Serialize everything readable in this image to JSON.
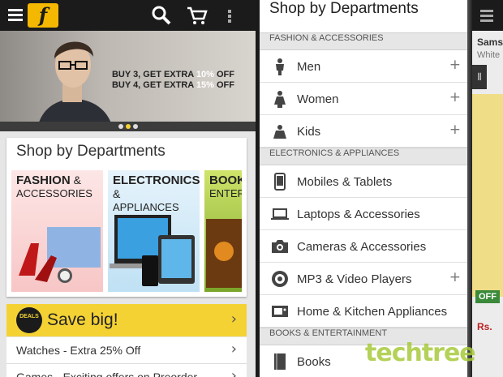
{
  "left": {
    "banner": {
      "line1_prefix": "BUY 3, GET EXTRA ",
      "line1_pct": "10%",
      "line1_suffix": " OFF",
      "line2_prefix": "BUY 4, GET EXTRA ",
      "line2_pct": "15%",
      "line2_suffix": " OFF"
    },
    "card_title": "Shop by Departments",
    "tiles": [
      {
        "line1": "FASHION",
        "amp": " &",
        "line2": "ACCESSORIES"
      },
      {
        "line1": "ELECTRONICS",
        "amp": " &",
        "line2": "APPLIANCES"
      },
      {
        "line1": "BOOKS",
        "amp": "",
        "line2": "ENTER"
      }
    ],
    "save_badge": "DEALS",
    "save_label": "Save big!",
    "rows": [
      "Watches - Extra 25% Off",
      "Games - Exciting offers on Preorder"
    ]
  },
  "drawer": {
    "title": "Shop by Departments",
    "sections": [
      {
        "header": "FASHION & ACCESSORIES",
        "items": [
          {
            "label": "Men",
            "icon": "man-icon",
            "expand": "+"
          },
          {
            "label": "Women",
            "icon": "woman-icon",
            "expand": "+"
          },
          {
            "label": "Kids",
            "icon": "kids-icon",
            "expand": "+"
          }
        ]
      },
      {
        "header": "ELECTRONICS & APPLIANCES",
        "items": [
          {
            "label": "Mobiles & Tablets",
            "icon": "mobile-icon",
            "expand": ""
          },
          {
            "label": "Laptops & Accessories",
            "icon": "laptop-icon",
            "expand": ""
          },
          {
            "label": "Cameras & Accessories",
            "icon": "camera-icon",
            "expand": ""
          },
          {
            "label": "MP3 & Video Players",
            "icon": "music-player-icon",
            "expand": "+"
          },
          {
            "label": "Home & Kitchen Appliances",
            "icon": "home-appliance-icon",
            "expand": ""
          }
        ]
      },
      {
        "header": "BOOKS & ENTERTAINMENT",
        "items": [
          {
            "label": "Books",
            "icon": "book-icon",
            "expand": ""
          }
        ]
      }
    ]
  },
  "right": {
    "title": "Sams",
    "subtitle": "White",
    "offer": "OFF",
    "price": "Rs."
  },
  "watermark": "techtree",
  "colors": {
    "accent": "#f4d234",
    "appbar": "#1b1b1b",
    "logo": "#f5b800"
  }
}
